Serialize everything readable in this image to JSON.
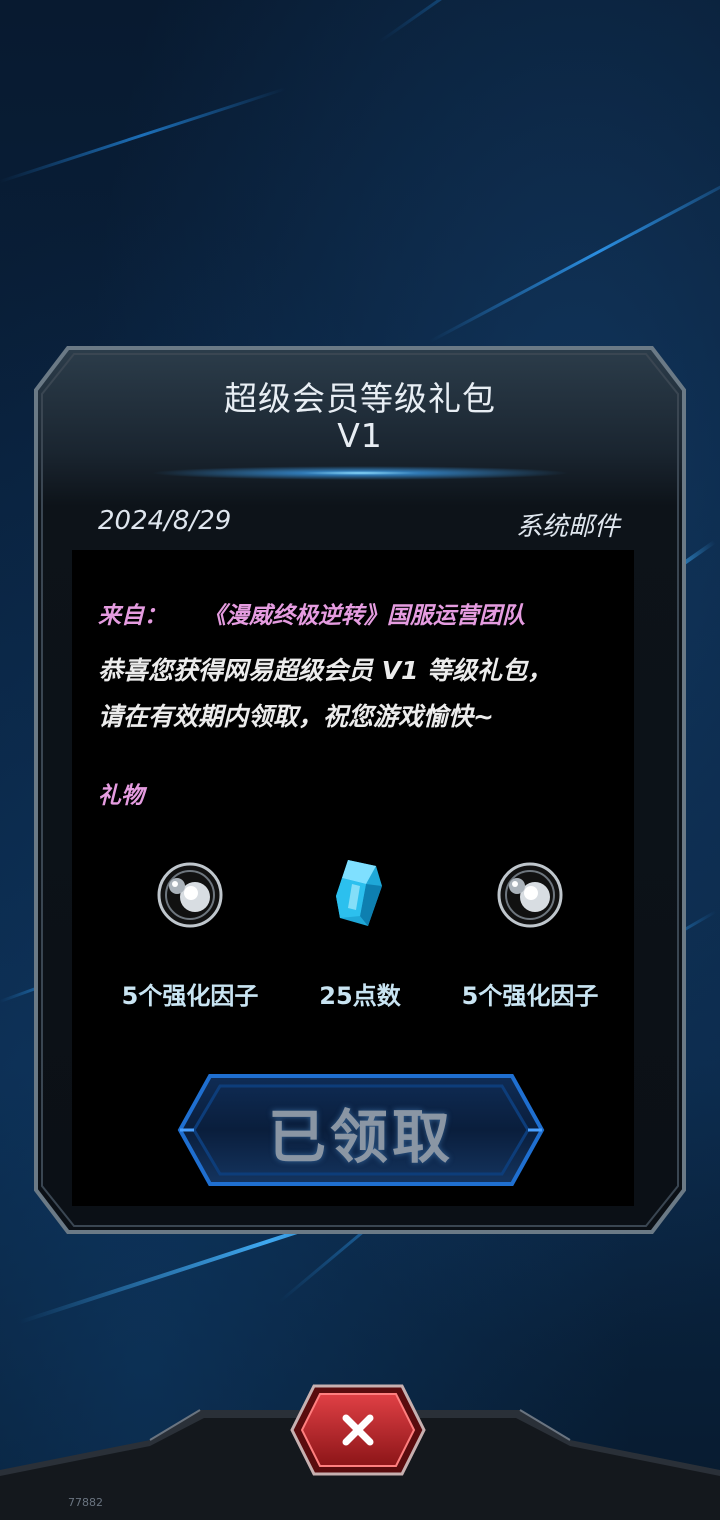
{
  "mail": {
    "title_line1": "超级会员等级礼包",
    "title_line2": "V1",
    "date": "2024/8/29",
    "type": "系统邮件",
    "from_label": "来自：",
    "from_source": "《漫威终极逆转》国服运营团队",
    "message_line1": "恭喜您获得网易超级会员 V1 等级礼包，",
    "message_line2": "请在有效期内领取，祝您游戏愉快~",
    "gift_label": "礼物",
    "rewards": [
      {
        "name": "5个强化因子",
        "icon": "enhancement-factor-icon"
      },
      {
        "name": "25点数",
        "icon": "crystal-points-icon"
      },
      {
        "name": "5个强化因子",
        "icon": "enhancement-factor-icon"
      }
    ],
    "claim_button_label": "已领取"
  },
  "close_button": {
    "icon": "close-icon"
  },
  "watermark": "77882",
  "colors": {
    "accent_pink": "#e59ce0",
    "close_red": "#c0282c",
    "glow_blue": "#3aa0f0"
  }
}
